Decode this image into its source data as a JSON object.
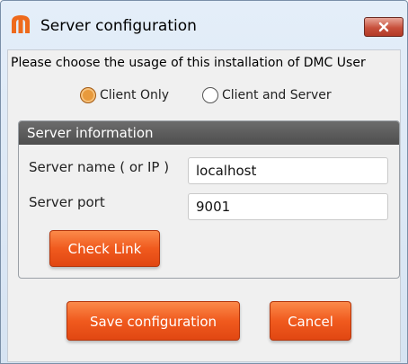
{
  "window": {
    "title": "Server configuration",
    "close_icon": "close-icon",
    "app_icon": "dmc-logo-icon"
  },
  "usage": {
    "prompt": "Please choose the usage of this installation of DMC User",
    "options": [
      {
        "label": "Client Only",
        "selected": true
      },
      {
        "label": "Client and Server",
        "selected": false
      }
    ]
  },
  "server_info": {
    "title": "Server information",
    "name_label": "Server name ( or IP )",
    "name_value": "localhost",
    "port_label": "Server port",
    "port_value": "9001",
    "check_link_label": "Check Link"
  },
  "actions": {
    "save_label": "Save configuration",
    "cancel_label": "Cancel"
  },
  "colors": {
    "accent": "#f05a1e",
    "panel_header": "#5a5a5a",
    "title_close": "#c7503c"
  }
}
